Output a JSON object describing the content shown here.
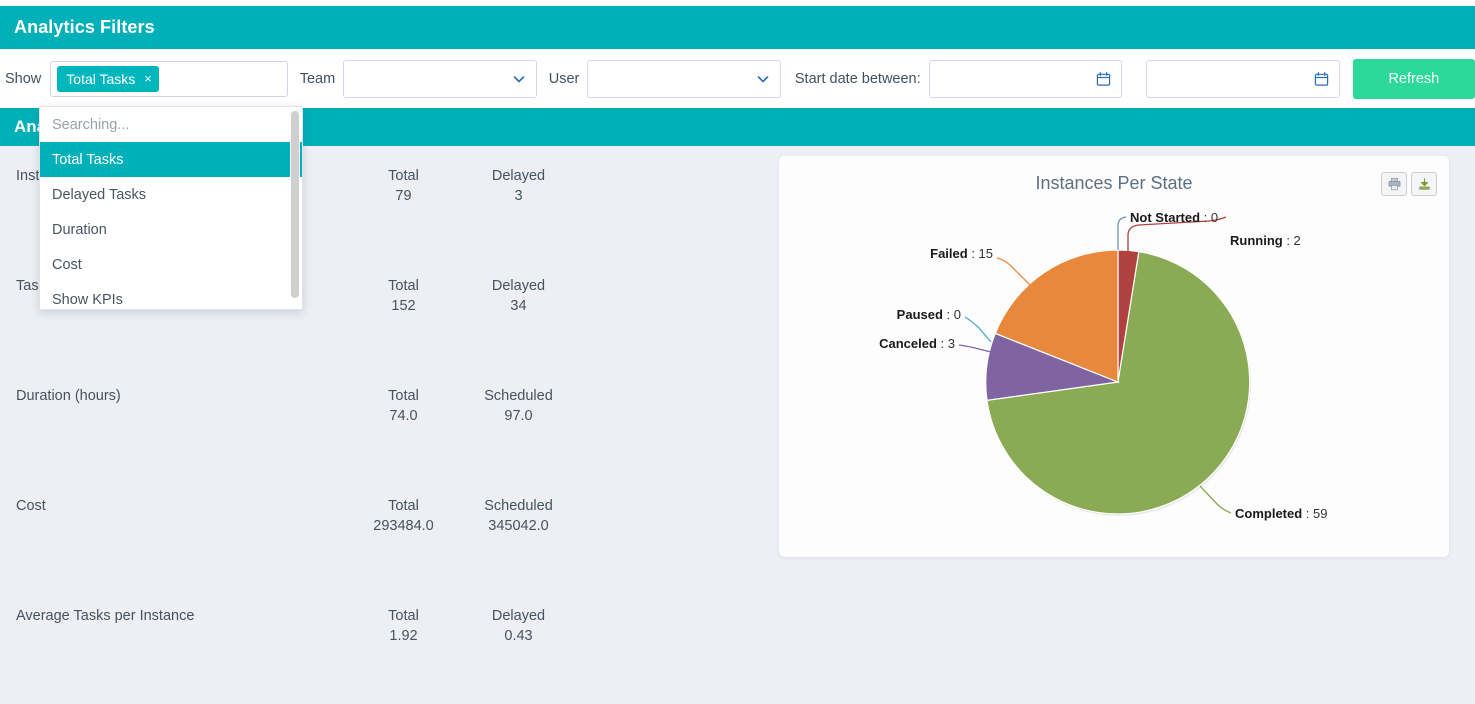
{
  "filters_panel": {
    "title": "Analytics Filters",
    "show_label": "Show",
    "selected_chip": "Total Tasks",
    "chip_remove": "×",
    "team_label": "Team",
    "team_value": "",
    "user_label": "User",
    "user_value": "",
    "start_date_label": "Start date between:",
    "start_date_from": "",
    "start_date_to": "",
    "refresh_label": "Refresh"
  },
  "dropdown": {
    "search_placeholder": "Searching...",
    "options": [
      {
        "label": "Total Tasks",
        "selected": true
      },
      {
        "label": "Delayed Tasks",
        "selected": false
      },
      {
        "label": "Duration",
        "selected": false
      },
      {
        "label": "Cost",
        "selected": false
      },
      {
        "label": "Show KPIs",
        "selected": false
      }
    ]
  },
  "analytics_panel": {
    "title": "Analytics"
  },
  "kpi_rows": [
    {
      "name": "Instances",
      "metrics": [
        {
          "label": "Total",
          "value": "79"
        },
        {
          "label": "Delayed",
          "value": "3"
        }
      ]
    },
    {
      "name": "Tasks",
      "metrics": [
        {
          "label": "Total",
          "value": "152"
        },
        {
          "label": "Delayed",
          "value": "34"
        }
      ]
    },
    {
      "name": "Duration (hours)",
      "metrics": [
        {
          "label": "Total",
          "value": "74.0"
        },
        {
          "label": "Scheduled",
          "value": "97.0"
        }
      ]
    },
    {
      "name": "Cost",
      "metrics": [
        {
          "label": "Total",
          "value": "293484.0"
        },
        {
          "label": "Scheduled",
          "value": "345042.0"
        }
      ]
    },
    {
      "name": "Average Tasks per Instance",
      "metrics": [
        {
          "label": "Total",
          "value": "1.92"
        },
        {
          "label": "Delayed",
          "value": "0.43"
        }
      ]
    }
  ],
  "chart_card": {
    "print_icon": "printer-icon",
    "download_icon": "download-icon"
  },
  "chart_data": {
    "type": "pie",
    "title": "Instances Per State",
    "categories": [
      "Not Started",
      "Running",
      "Completed",
      "Canceled",
      "Paused",
      "Failed"
    ],
    "values": [
      0,
      2,
      59,
      3,
      0,
      15
    ],
    "labels": [
      "Not Started : 0",
      "Running : 2",
      "Completed : 59",
      "Canceled : 3",
      "Paused : 0",
      "Failed : 15"
    ],
    "colors": [
      "#4f81bd",
      "#b0413e",
      "#8aab53",
      "#8064a2",
      "#4bacc6",
      "#e8883c"
    ],
    "total": 79,
    "legend": "none",
    "grid": false
  },
  "colors": {
    "teal": "#00b0b9",
    "chip_teal": "#00b6bd",
    "mint": "#2bd99a",
    "page_bg": "#edeff4",
    "text": "#46525f"
  }
}
